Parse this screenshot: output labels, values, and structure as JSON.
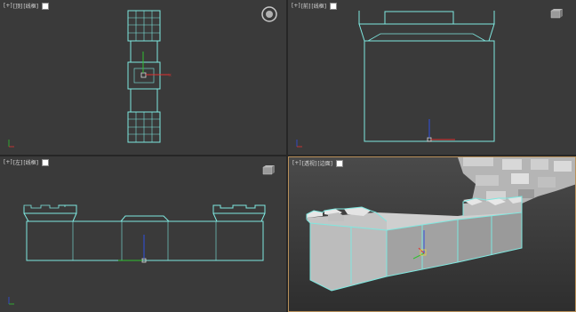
{
  "viewports": {
    "top": {
      "tokens": [
        "[+]",
        "[顶]",
        "[线框]"
      ]
    },
    "front": {
      "tokens": [
        "[+]",
        "[前]",
        "[线框]"
      ]
    },
    "left": {
      "tokens": [
        "[+]",
        "[左]",
        "[线框]"
      ]
    },
    "persp": {
      "tokens": [
        "[+]",
        "[透视]",
        "[边面]"
      ]
    }
  },
  "colors": {
    "wire": "#7fe8e0",
    "grid": "#5a5a5a",
    "active_border": "#b8905a",
    "axis_x": "#e03030",
    "axis_y": "#30c030",
    "axis_z": "#3050e0"
  },
  "icons": [
    "viewcube-icon",
    "nav-orbit-icon",
    "gizmo-icon"
  ]
}
